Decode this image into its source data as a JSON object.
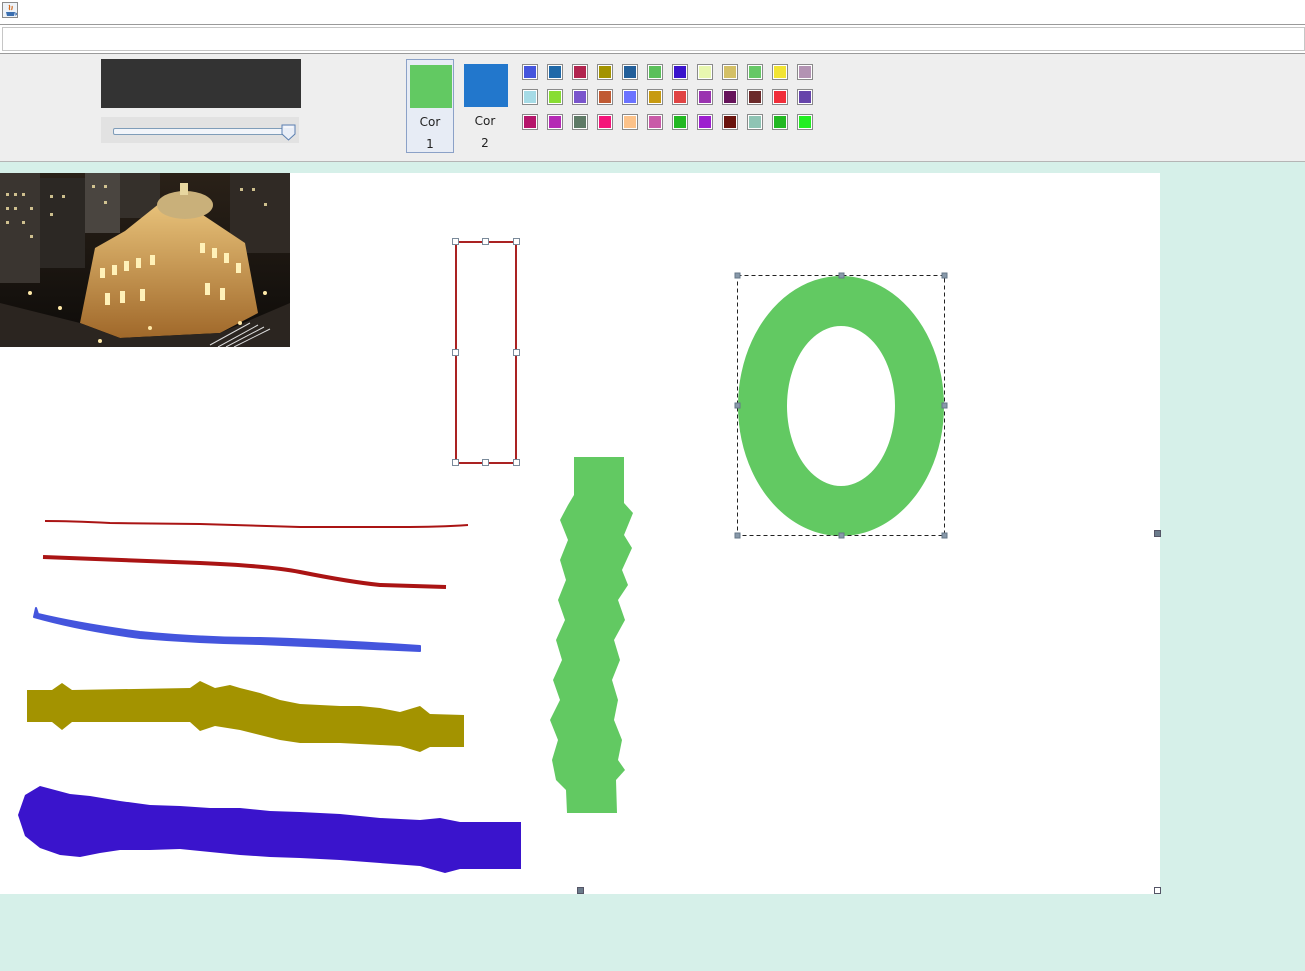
{
  "window": {
    "icon": "java-app-icon"
  },
  "color_buttons": [
    {
      "label_line1": "Cor",
      "label_line2": "1",
      "color": "#62c962",
      "selected": true
    },
    {
      "label_line1": "Cor",
      "label_line2": "2",
      "color": "#2277cc",
      "selected": false
    }
  ],
  "preview_color": "#333333",
  "slider": {
    "value_fraction": 0.97
  },
  "palette": [
    [
      "#4455dd",
      "#1f68a8",
      "#b1244e",
      "#a39300",
      "#225f9a",
      "#5ac05a",
      "#3a14cc",
      "#e8f7b0",
      "#d4c066",
      "#66c866",
      "#f2e434",
      "#b393b3"
    ],
    [
      "#a6dbe6",
      "#88dd33",
      "#7a55cc",
      "#c05a33",
      "#6b73ff",
      "#c79a10",
      "#e04444",
      "#9a33b0",
      "#66145a",
      "#6b2a2a",
      "#f02e3a",
      "#6644aa"
    ],
    [
      "#b5166b",
      "#b52ab5",
      "#5e7a66",
      "#f4147a",
      "#fcc28a",
      "#c95aa8",
      "#22b822",
      "#9d1fcf",
      "#6b140e",
      "#8fc4b4",
      "#22b822",
      "#22ee22"
    ]
  ],
  "canvas": {
    "background": "#ffffff",
    "shapes": {
      "rectangle_stroke": "#aa2222",
      "ring_fill": "#62c962",
      "strokes": [
        "#aa1414",
        "#aa1414",
        "#4455dd",
        "#a39300",
        "#3a14cc",
        "#62c962"
      ]
    }
  }
}
